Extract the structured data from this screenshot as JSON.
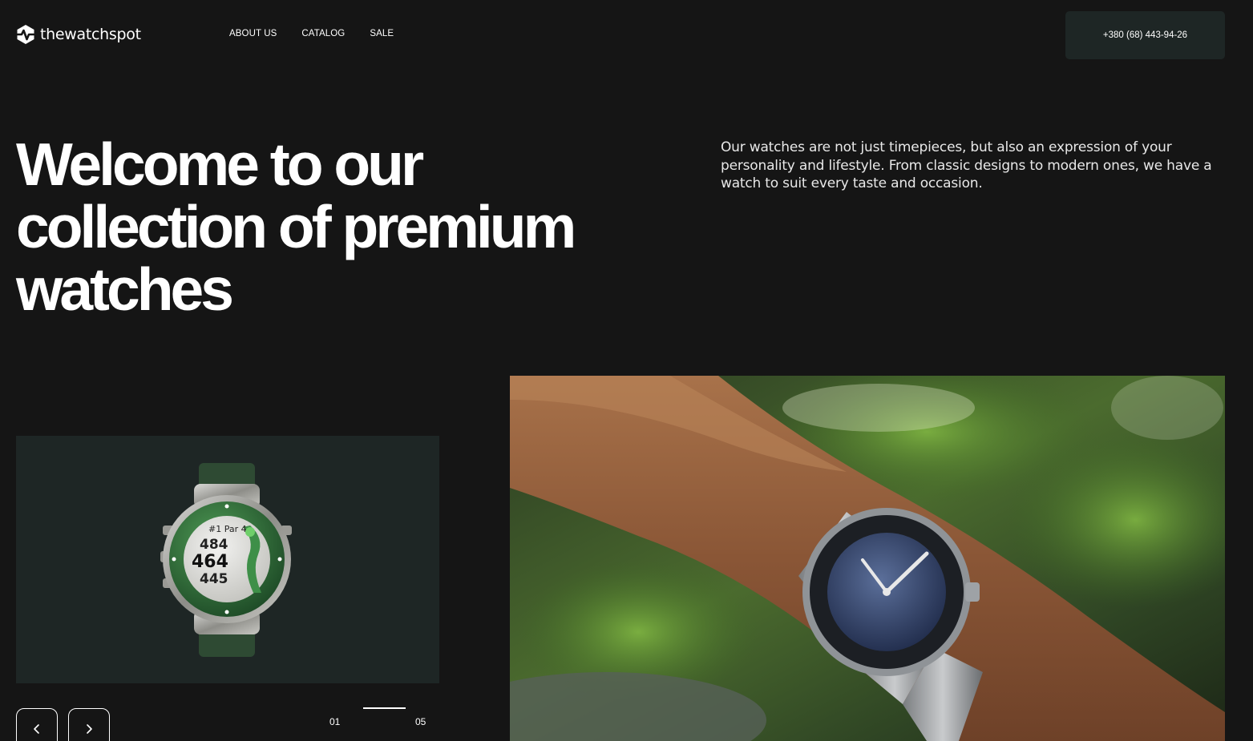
{
  "brand": {
    "name": "thewatchspot",
    "icon": "logo-pulse-icon"
  },
  "nav": {
    "items": [
      "ABOUT US",
      "CATALOG",
      "SALE"
    ]
  },
  "contact": {
    "phone": "+380 (68) 443-94-26"
  },
  "hero": {
    "headline": "Welcome to our collection of premium watches",
    "description": "Our watches are not just timepieces, but also an expression of your personality and lifestyle. From classic designs to modern ones, we have a watch to suit every taste and occasion."
  },
  "product_card": {
    "display": {
      "line1": "#1 Par 4",
      "line2": "484",
      "line3": "464",
      "line4": "445"
    }
  },
  "slider": {
    "current": "01",
    "total": "05",
    "prev_icon": "chevron-left-icon",
    "next_icon": "chevron-right-icon"
  },
  "colors": {
    "background": "#151515",
    "card": "#1e2625",
    "text": "#ffffff"
  }
}
